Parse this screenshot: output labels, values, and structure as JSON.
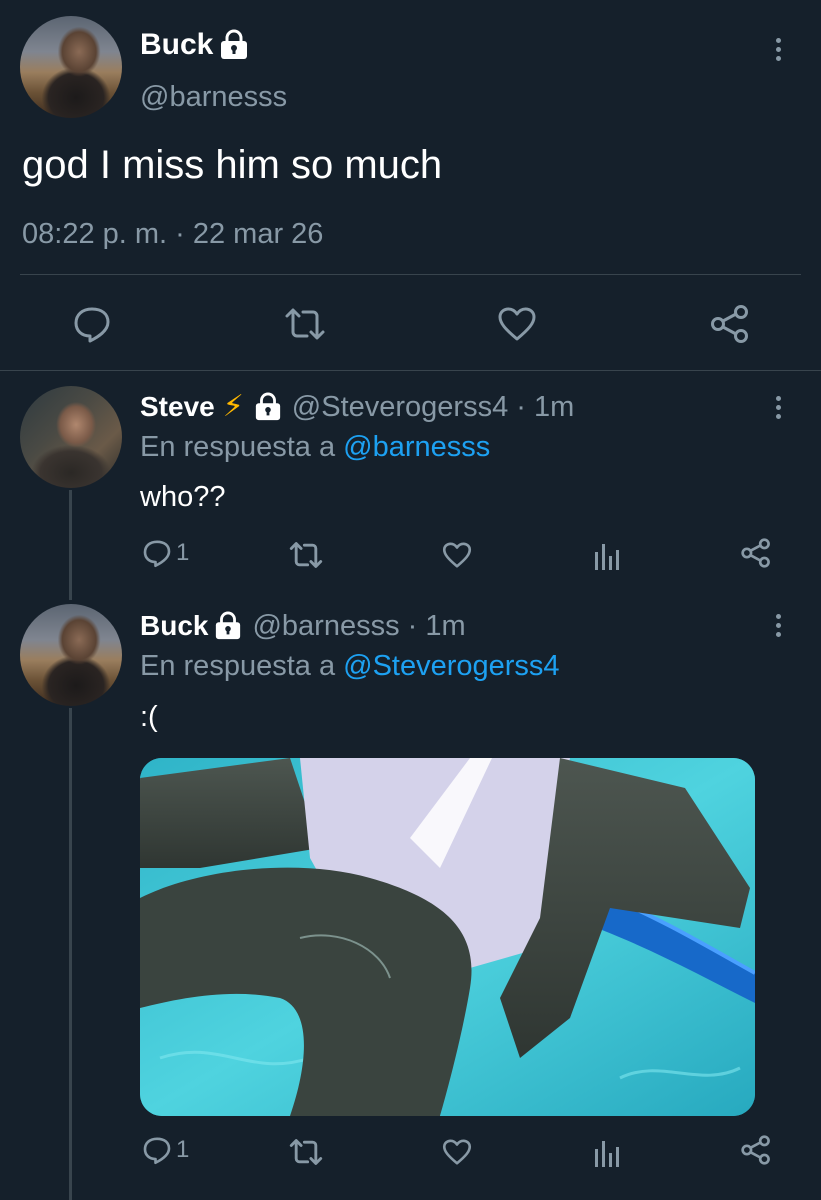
{
  "main_tweet": {
    "display_name": "Buck",
    "handle": "@barnesss",
    "text": "god I miss him so much",
    "timestamp": "08:22 p. m. · 22 mar 26"
  },
  "reply_1": {
    "display_name": "Steve",
    "badge_emoji": "⚡",
    "handle_time": "@Steverogerss4 · 1m",
    "reply_prefix": "En respuesta a",
    "reply_to": "@barnesss",
    "text": "who??",
    "reply_count": "1"
  },
  "reply_2": {
    "display_name": "Buck",
    "handle_time": "@barnesss · 1m",
    "reply_prefix": "En respuesta a",
    "reply_to": "@Steverogerss4",
    "text": ":(",
    "reply_count": "1"
  },
  "colors": {
    "background": "#15202b",
    "muted": "#8899a6",
    "link": "#1da1f2",
    "divider": "#38444d"
  }
}
